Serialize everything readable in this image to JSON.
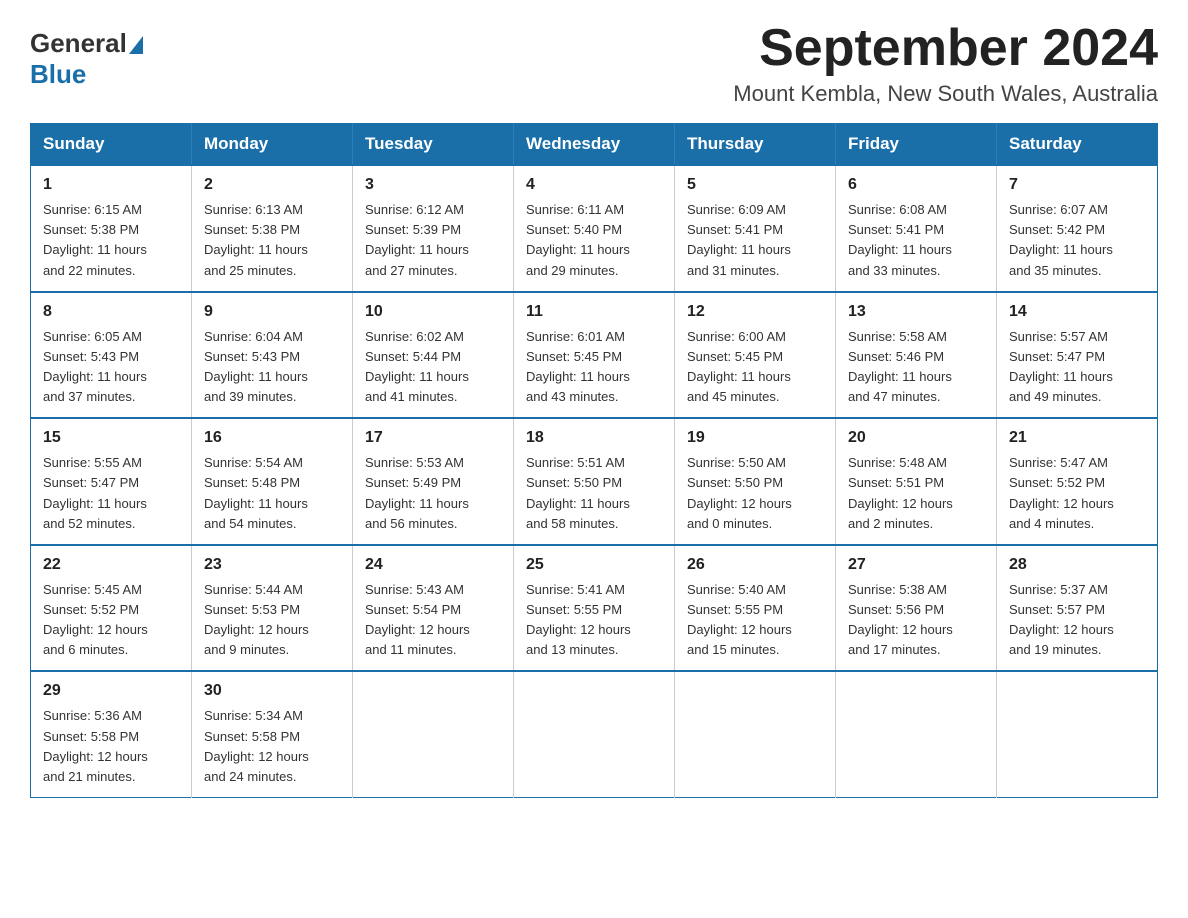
{
  "logo": {
    "general": "General",
    "arrow_shape": "triangle",
    "blue": "Blue"
  },
  "title": {
    "month_year": "September 2024",
    "location": "Mount Kembla, New South Wales, Australia"
  },
  "days_of_week": [
    "Sunday",
    "Monday",
    "Tuesday",
    "Wednesday",
    "Thursday",
    "Friday",
    "Saturday"
  ],
  "weeks": [
    [
      {
        "day": "1",
        "sunrise": "6:15 AM",
        "sunset": "5:38 PM",
        "daylight": "11 hours and 22 minutes."
      },
      {
        "day": "2",
        "sunrise": "6:13 AM",
        "sunset": "5:38 PM",
        "daylight": "11 hours and 25 minutes."
      },
      {
        "day": "3",
        "sunrise": "6:12 AM",
        "sunset": "5:39 PM",
        "daylight": "11 hours and 27 minutes."
      },
      {
        "day": "4",
        "sunrise": "6:11 AM",
        "sunset": "5:40 PM",
        "daylight": "11 hours and 29 minutes."
      },
      {
        "day": "5",
        "sunrise": "6:09 AM",
        "sunset": "5:41 PM",
        "daylight": "11 hours and 31 minutes."
      },
      {
        "day": "6",
        "sunrise": "6:08 AM",
        "sunset": "5:41 PM",
        "daylight": "11 hours and 33 minutes."
      },
      {
        "day": "7",
        "sunrise": "6:07 AM",
        "sunset": "5:42 PM",
        "daylight": "11 hours and 35 minutes."
      }
    ],
    [
      {
        "day": "8",
        "sunrise": "6:05 AM",
        "sunset": "5:43 PM",
        "daylight": "11 hours and 37 minutes."
      },
      {
        "day": "9",
        "sunrise": "6:04 AM",
        "sunset": "5:43 PM",
        "daylight": "11 hours and 39 minutes."
      },
      {
        "day": "10",
        "sunrise": "6:02 AM",
        "sunset": "5:44 PM",
        "daylight": "11 hours and 41 minutes."
      },
      {
        "day": "11",
        "sunrise": "6:01 AM",
        "sunset": "5:45 PM",
        "daylight": "11 hours and 43 minutes."
      },
      {
        "day": "12",
        "sunrise": "6:00 AM",
        "sunset": "5:45 PM",
        "daylight": "11 hours and 45 minutes."
      },
      {
        "day": "13",
        "sunrise": "5:58 AM",
        "sunset": "5:46 PM",
        "daylight": "11 hours and 47 minutes."
      },
      {
        "day": "14",
        "sunrise": "5:57 AM",
        "sunset": "5:47 PM",
        "daylight": "11 hours and 49 minutes."
      }
    ],
    [
      {
        "day": "15",
        "sunrise": "5:55 AM",
        "sunset": "5:47 PM",
        "daylight": "11 hours and 52 minutes."
      },
      {
        "day": "16",
        "sunrise": "5:54 AM",
        "sunset": "5:48 PM",
        "daylight": "11 hours and 54 minutes."
      },
      {
        "day": "17",
        "sunrise": "5:53 AM",
        "sunset": "5:49 PM",
        "daylight": "11 hours and 56 minutes."
      },
      {
        "day": "18",
        "sunrise": "5:51 AM",
        "sunset": "5:50 PM",
        "daylight": "11 hours and 58 minutes."
      },
      {
        "day": "19",
        "sunrise": "5:50 AM",
        "sunset": "5:50 PM",
        "daylight": "12 hours and 0 minutes."
      },
      {
        "day": "20",
        "sunrise": "5:48 AM",
        "sunset": "5:51 PM",
        "daylight": "12 hours and 2 minutes."
      },
      {
        "day": "21",
        "sunrise": "5:47 AM",
        "sunset": "5:52 PM",
        "daylight": "12 hours and 4 minutes."
      }
    ],
    [
      {
        "day": "22",
        "sunrise": "5:45 AM",
        "sunset": "5:52 PM",
        "daylight": "12 hours and 6 minutes."
      },
      {
        "day": "23",
        "sunrise": "5:44 AM",
        "sunset": "5:53 PM",
        "daylight": "12 hours and 9 minutes."
      },
      {
        "day": "24",
        "sunrise": "5:43 AM",
        "sunset": "5:54 PM",
        "daylight": "12 hours and 11 minutes."
      },
      {
        "day": "25",
        "sunrise": "5:41 AM",
        "sunset": "5:55 PM",
        "daylight": "12 hours and 13 minutes."
      },
      {
        "day": "26",
        "sunrise": "5:40 AM",
        "sunset": "5:55 PM",
        "daylight": "12 hours and 15 minutes."
      },
      {
        "day": "27",
        "sunrise": "5:38 AM",
        "sunset": "5:56 PM",
        "daylight": "12 hours and 17 minutes."
      },
      {
        "day": "28",
        "sunrise": "5:37 AM",
        "sunset": "5:57 PM",
        "daylight": "12 hours and 19 minutes."
      }
    ],
    [
      {
        "day": "29",
        "sunrise": "5:36 AM",
        "sunset": "5:58 PM",
        "daylight": "12 hours and 21 minutes."
      },
      {
        "day": "30",
        "sunrise": "5:34 AM",
        "sunset": "5:58 PM",
        "daylight": "12 hours and 24 minutes."
      },
      null,
      null,
      null,
      null,
      null
    ]
  ],
  "labels": {
    "sunrise": "Sunrise:",
    "sunset": "Sunset:",
    "daylight": "Daylight:"
  }
}
